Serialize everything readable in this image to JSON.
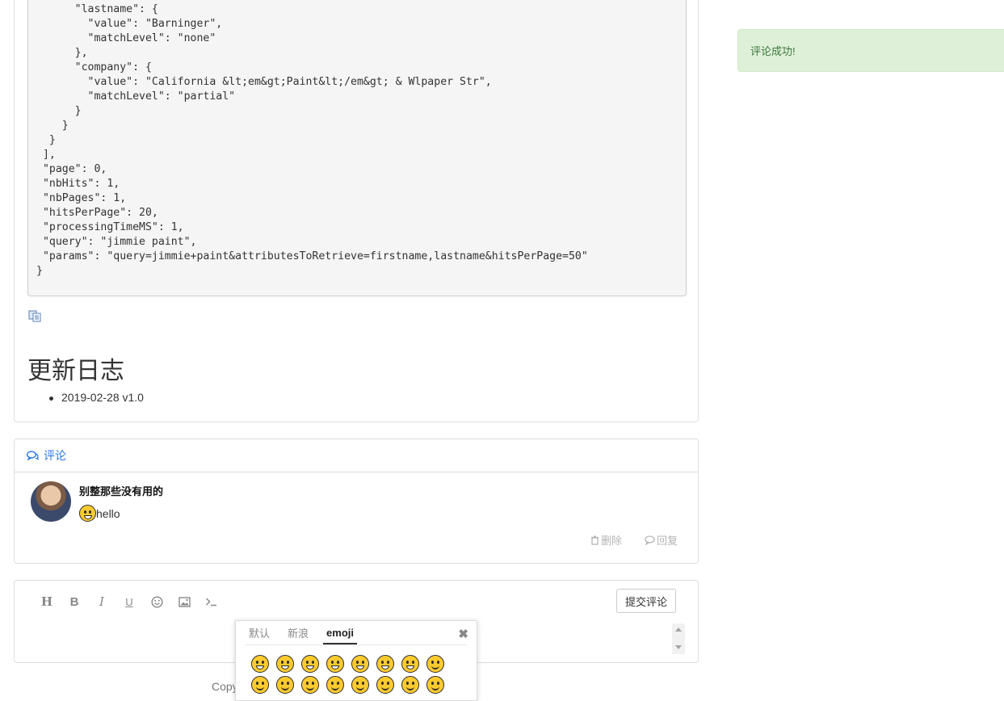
{
  "article": {
    "code_lines": [
      "      },",
      "      \"lastname\": {",
      "        \"value\": \"Barninger\",",
      "        \"matchLevel\": \"none\"",
      "      },",
      "      \"company\": {",
      "        \"value\": \"California &lt;em&gt;Paint&lt;/em&gt; & Wlpaper Str\",",
      "        \"matchLevel\": \"partial\"",
      "      }",
      "    }",
      "  }",
      " ],",
      " \"page\": 0,",
      " \"nbHits\": 1,",
      " \"nbPages\": 1,",
      " \"hitsPerPage\": 20,",
      " \"processingTimeMS\": 1,",
      " \"query\": \"jimmie paint\",",
      " \"params\": \"query=jimmie+paint&attributesToRetrieve=firstname,lastname&hitsPerPage=50\"",
      "}"
    ],
    "changelog_title": "更新日志",
    "changelog_items": [
      "2019-02-28 v1.0"
    ]
  },
  "comments": {
    "header_label": "评论",
    "items": [
      {
        "author": "别整那些没有用的",
        "text": "hello",
        "delete_label": "删除",
        "reply_label": "回复"
      }
    ]
  },
  "editor": {
    "tools": [
      "H",
      "B",
      "I",
      "U"
    ],
    "submit_label": "提交评论"
  },
  "emoji_picker": {
    "tabs": [
      "默认",
      "新浪",
      "emoji"
    ],
    "active_tab": "emoji",
    "close_glyph": "✖"
  },
  "footer": {
    "copyright_partial": "Copy"
  },
  "alert": {
    "message": "评论成功!"
  },
  "colors": {
    "link_blue": "#2a7ae2",
    "alert_bg": "#dff0d8",
    "alert_text": "#3c763d"
  }
}
